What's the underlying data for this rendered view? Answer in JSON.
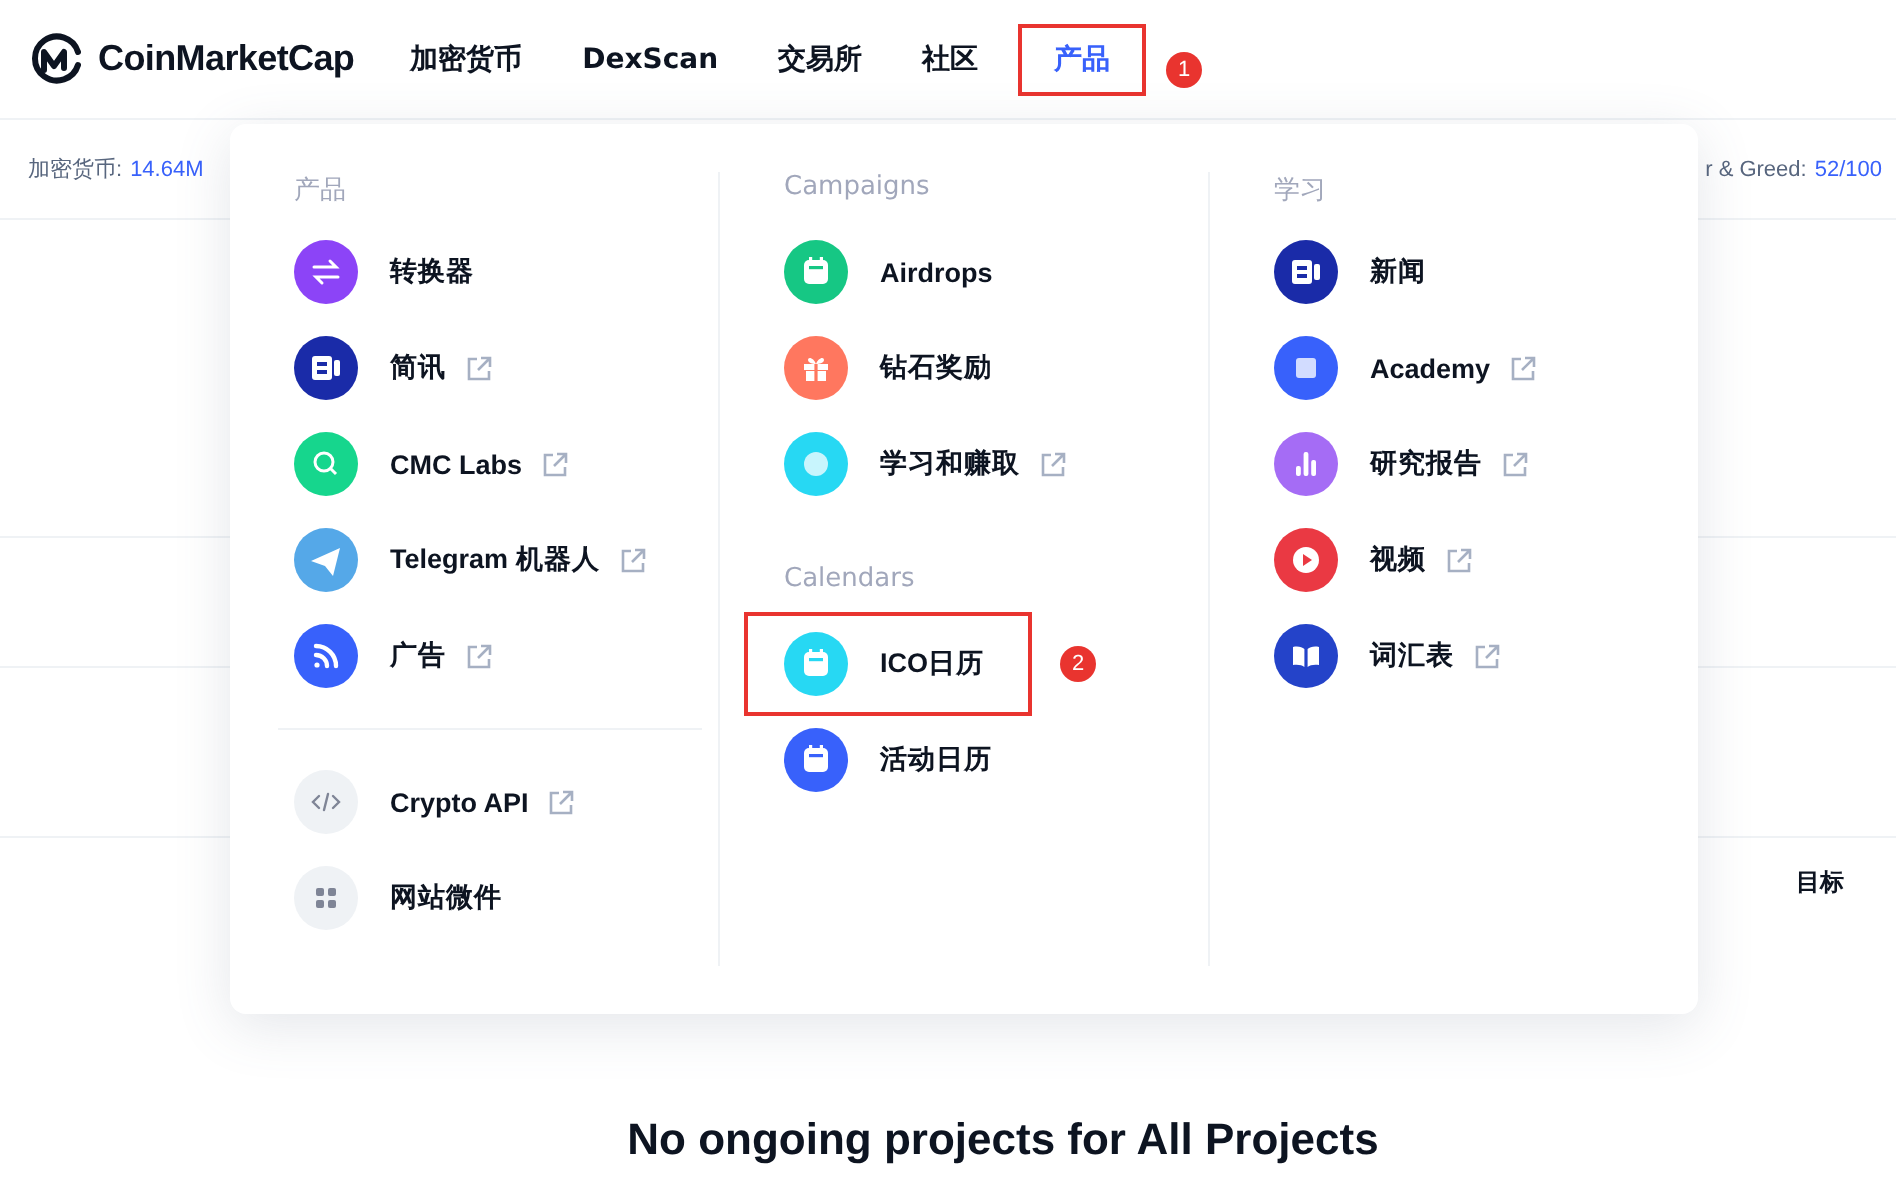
{
  "header": {
    "logo": "CoinMarketCap",
    "nav": [
      {
        "label": "加密货币",
        "selected": false
      },
      {
        "label": "DexScan",
        "selected": false
      },
      {
        "label": "交易所",
        "selected": false
      },
      {
        "label": "社区",
        "selected": false
      },
      {
        "label": "产品",
        "selected": true,
        "marker": "1"
      }
    ]
  },
  "stats_bar": {
    "left_label": "加密货币:",
    "left_value": "14.64M",
    "right_label": "r & Greed:",
    "right_value": "52/100"
  },
  "menu": {
    "columns": [
      {
        "groups": [
          {
            "title": "产品",
            "items": [
              {
                "label": "转换器",
                "kind": "swap",
                "color": "#8c44f7",
                "external": false
              },
              {
                "label": "简讯",
                "kind": "news",
                "color": "#1a2ba8",
                "external": true
              },
              {
                "label": "CMC Labs",
                "kind": "search",
                "color": "#16d68d",
                "external": true
              },
              {
                "label": "Telegram 机器人",
                "kind": "send",
                "color": "#55a8e8",
                "external": true
              },
              {
                "label": "广告",
                "kind": "rss",
                "color": "#3861fb",
                "external": true
              }
            ]
          },
          {
            "items": [
              {
                "label": "Crypto API",
                "kind": "code",
                "color": "#eff2f5",
                "external": true
              },
              {
                "label": "网站微件",
                "kind": "grid",
                "color": "#eff2f5",
                "external": false
              }
            ]
          }
        ]
      },
      {
        "groups": [
          {
            "title": "Campaigns",
            "items": [
              {
                "label": "Airdrops",
                "kind": "calendar",
                "color": "#16c784",
                "external": false
              },
              {
                "label": "钻石奖励",
                "kind": "gift",
                "color": "#ff775f",
                "external": false
              },
              {
                "label": "学习和赚取",
                "kind": "dot",
                "color": "#27d8f3",
                "external": true
              }
            ]
          },
          {
            "title": "Calendars",
            "items": [
              {
                "label": "ICO日历",
                "kind": "calendar",
                "color": "#27d8f3",
                "external": false,
                "marker": "2"
              },
              {
                "label": "活动日历",
                "kind": "calendar",
                "color": "#3861fb",
                "external": false
              }
            ]
          }
        ]
      },
      {
        "groups": [
          {
            "title": "学习",
            "items": [
              {
                "label": "新闻",
                "kind": "news",
                "color": "#1a2ba8",
                "external": false
              },
              {
                "label": "Academy",
                "kind": "square",
                "color": "#3861fb",
                "external": true
              },
              {
                "label": "研究报告",
                "kind": "chart",
                "color": "#a56cf5",
                "external": true
              },
              {
                "label": "视频",
                "kind": "play",
                "color": "#ea3943",
                "external": true
              },
              {
                "label": "词汇表",
                "kind": "book",
                "color": "#2443c9",
                "external": true
              }
            ]
          }
        ]
      }
    ]
  },
  "table": {
    "column_label": "目标"
  },
  "heading": "No ongoing projects for All Projects"
}
